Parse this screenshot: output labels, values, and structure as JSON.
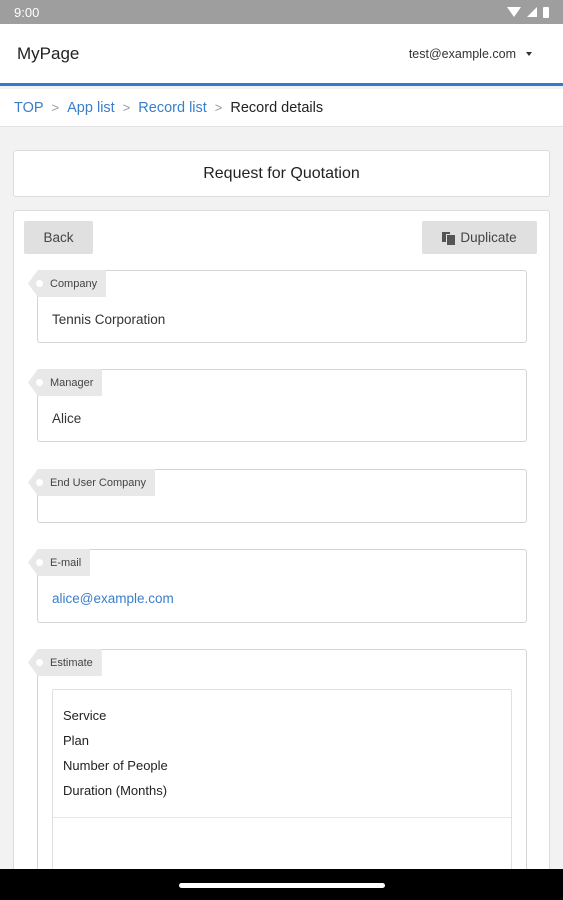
{
  "status_bar": {
    "time": "9:00",
    "icons": [
      "wifi-icon",
      "signal-icon",
      "battery-icon"
    ]
  },
  "header": {
    "title": "MyPage",
    "user_email": "test@example.com"
  },
  "breadcrumb": {
    "items": [
      {
        "label": "TOP",
        "link": true
      },
      {
        "label": "App list",
        "link": true
      },
      {
        "label": "Record list",
        "link": true
      },
      {
        "label": "Record details",
        "link": false
      }
    ],
    "separator": ">"
  },
  "page": {
    "title": "Request for Quotation"
  },
  "toolbar": {
    "back_label": "Back",
    "duplicate_label": "Duplicate"
  },
  "fields": {
    "company": {
      "label": "Company",
      "value": "Tennis Corporation"
    },
    "manager": {
      "label": "Manager",
      "value": "Alice"
    },
    "end_user_company": {
      "label": "End User Company",
      "value": ""
    },
    "email": {
      "label": "E-mail",
      "value": "alice@example.com"
    },
    "estimate": {
      "label": "Estimate",
      "columns": [
        "Service",
        "Plan",
        "Number of People",
        "Duration (Months)"
      ]
    }
  },
  "colors": {
    "accent": "#2f7bd1",
    "link": "#3a7ec9",
    "status_bar": "#9e9e9e"
  }
}
